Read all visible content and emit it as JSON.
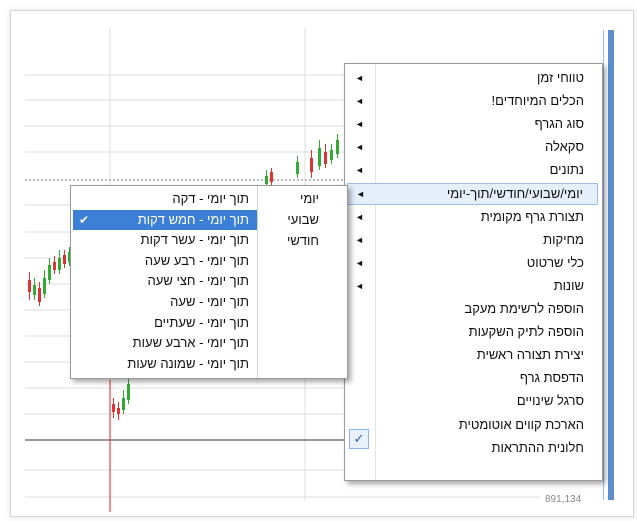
{
  "chart": {
    "price_label": "891,134"
  },
  "context_menu": {
    "items": [
      {
        "label": "טווחי זמן",
        "submenu": true
      },
      {
        "label": "הכלים המיוחדים!",
        "submenu": true
      },
      {
        "label": "סוג הגרף",
        "submenu": true
      },
      {
        "label": "סקאלה",
        "submenu": true
      },
      {
        "label": "נתונים",
        "submenu": true
      },
      {
        "label": "יומי/שבועי/חודשי/תוך-יומי",
        "submenu": true,
        "highlighted": true
      },
      {
        "label": "תצורת גרף מקומית",
        "submenu": true
      },
      {
        "label": "מחיקות",
        "submenu": true
      },
      {
        "label": "כלי שרטוט",
        "submenu": true
      },
      {
        "label": "שונות",
        "submenu": true
      },
      {
        "label": "הוספה לרשימת מעקב",
        "submenu": false
      },
      {
        "label": "הוספה לתיק השקעות",
        "submenu": false
      },
      {
        "label": "יצירת תצורה ראשית",
        "submenu": false
      },
      {
        "label": "הדפסת גרף",
        "submenu": false
      },
      {
        "label": "סרגל שינויים",
        "submenu": false
      },
      {
        "label": "הארכת קווים אוטומטית",
        "submenu": false,
        "checked": true
      },
      {
        "label": "חלונית ההתראות",
        "submenu": false
      }
    ],
    "check_mark": "✓",
    "submenu_arrow": "◄"
  },
  "submenu": {
    "period_column": [
      {
        "label": "יומי"
      },
      {
        "label": "שבועי"
      },
      {
        "label": "חודשי"
      }
    ],
    "intraday_column": [
      {
        "label": "תוך יומי - דקה"
      },
      {
        "label": "תוך יומי - חמש דקות",
        "selected": true
      },
      {
        "label": "תוך יומי - עשר דקות"
      },
      {
        "label": "תוך יומי - רבע שעה"
      },
      {
        "label": "תוך יומי - חצי שעה"
      },
      {
        "label": "תוך יומי - שעה"
      },
      {
        "label": "תוך יומי - שעתיים"
      },
      {
        "label": "תוך יומי - ארבע שעות"
      },
      {
        "label": "תוך יומי - שמונה שעות"
      }
    ],
    "selected_mark": "✔"
  }
}
